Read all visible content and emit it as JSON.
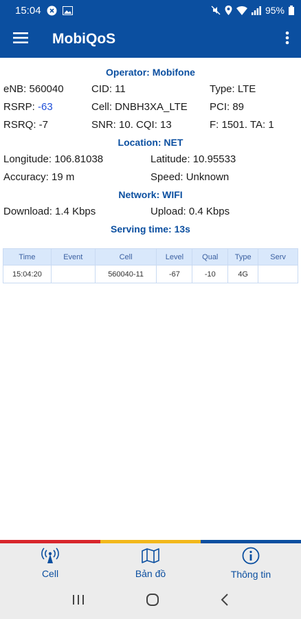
{
  "status_bar": {
    "time": "15:04",
    "battery": "95%"
  },
  "app_bar": {
    "title": "MobiQoS"
  },
  "operator": {
    "title": "Operator: Mobifone",
    "enb": "eNB: 560040",
    "cid": "CID: 11",
    "type": "Type: LTE",
    "rsrp_label": "RSRP: ",
    "rsrp_value": "-63",
    "cell": "Cell: DNBH3XA_LTE",
    "pci": "PCI: 89",
    "rsrq": "RSRQ: -7",
    "snr": "SNR: 10. CQI: 13",
    "freq": "F: 1501. TA: 1"
  },
  "location": {
    "title": "Location: NET",
    "longitude": "Longitude: 106.81038",
    "latitude": "Latitude: 10.95533",
    "accuracy": "Accuracy: 19 m",
    "speed": "Speed: Unknown"
  },
  "network": {
    "title": "Network: WIFI",
    "download": "Download: 1.4 Kbps",
    "upload": "Upload: 0.4 Kbps"
  },
  "serving_time": "Serving time: 13s",
  "table": {
    "headers": [
      "Time",
      "Event",
      "Cell",
      "Level",
      "Qual",
      "Type",
      "Serv"
    ],
    "rows": [
      [
        "15:04:20",
        "",
        "560040-11",
        "-67",
        "-10",
        "4G",
        ""
      ]
    ]
  },
  "bottom_nav": {
    "cell": "Cell",
    "map": "Bản đồ",
    "info": "Thông tin"
  },
  "colors": {
    "primary": "#0b4fa0",
    "stripe_red": "#d8262c",
    "stripe_yellow": "#f2b81c",
    "stripe_blue": "#0b4fa0"
  }
}
